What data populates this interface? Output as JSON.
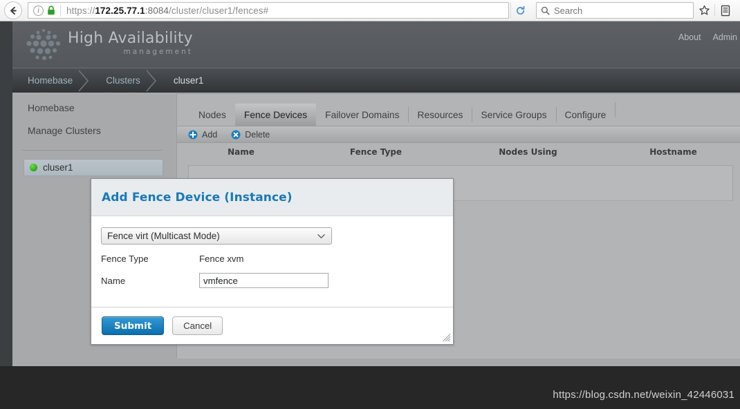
{
  "browser": {
    "back_icon": "back-arrow-icon",
    "info_icon": "site-info-icon",
    "lock_icon": "padlock-icon",
    "url_scheme": "https://",
    "url_host": "172.25.77.1",
    "url_port": ":8084",
    "url_path": "/cluster/cluser1/fences#",
    "reload_icon": "reload-icon",
    "search_placeholder": "Search",
    "search_value": "",
    "search_icon": "search-icon",
    "bookmark_icon": "star-icon",
    "library_icon": "library-icon"
  },
  "header": {
    "logo_icon": "honeycomb-dots-logo",
    "title": "High Availability",
    "subtitle": "management",
    "links": [
      {
        "label": "About"
      },
      {
        "label": "Admin"
      }
    ]
  },
  "breadcrumb": {
    "items": [
      {
        "label": "Homebase",
        "current": false
      },
      {
        "label": "Clusters",
        "current": false
      },
      {
        "label": "cluser1",
        "current": true
      }
    ]
  },
  "sidebar": {
    "links": [
      {
        "label": "Homebase"
      },
      {
        "label": "Manage Clusters"
      }
    ],
    "clusters": [
      {
        "label": "cluser1",
        "status": "online",
        "status_color": "#2ca51b",
        "selected": true
      }
    ]
  },
  "main": {
    "tabs": [
      {
        "label": "Nodes",
        "active": false
      },
      {
        "label": "Fence Devices",
        "active": true
      },
      {
        "label": "Failover Domains",
        "active": false
      },
      {
        "label": "Resources",
        "active": false
      },
      {
        "label": "Service Groups",
        "active": false
      },
      {
        "label": "Configure",
        "active": false
      }
    ],
    "toolbar": [
      {
        "label": "Add",
        "icon": "plus-circle-icon",
        "color": "#1b7fb8"
      },
      {
        "label": "Delete",
        "icon": "x-circle-icon",
        "color": "#1b7fb8"
      }
    ],
    "table": {
      "columns": [
        "Name",
        "Fence Type",
        "Nodes Using",
        "Hostname"
      ],
      "rows": []
    }
  },
  "modal": {
    "title": "Add Fence Device (Instance)",
    "accent_color": "#1979b8",
    "device_select": {
      "value": "Fence virt (Multicast Mode)",
      "chevron_icon": "chevron-down-icon"
    },
    "fields": [
      {
        "label": "Fence Type",
        "type": "static",
        "value": "Fence xvm"
      },
      {
        "label": "Name",
        "type": "input",
        "value": "vmfence"
      }
    ],
    "submit_label": "Submit",
    "cancel_label": "Cancel",
    "resize_icon": "resize-grip-icon"
  },
  "watermark": "https://blog.csdn.net/weixin_42446031"
}
